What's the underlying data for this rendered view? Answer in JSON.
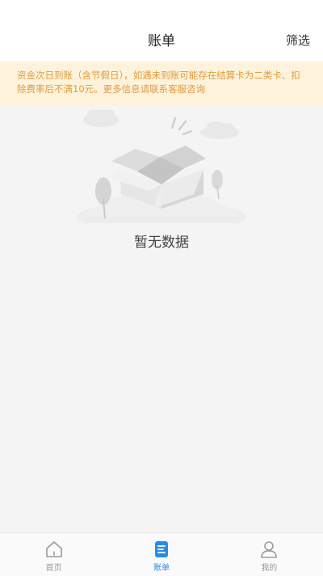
{
  "header": {
    "title": "账单",
    "filter_label": "筛选"
  },
  "notice": {
    "text": "资金次日到账（含节假日），如遇未到账可能存在结算卡为二类卡、扣除费率后不满10元。更多信息请联系客服咨询"
  },
  "empty_state": {
    "text": "暂无数据",
    "illustration": "empty-box-icon"
  },
  "tabbar": {
    "active_color": "#2b8be8",
    "items": [
      {
        "label": "首页",
        "icon": "home-icon",
        "active": false
      },
      {
        "label": "账单",
        "icon": "bill-icon",
        "active": true
      },
      {
        "label": "我的",
        "icon": "user-icon",
        "active": false
      }
    ]
  },
  "colors": {
    "notice_bg": "#fdf3dc",
    "notice_text": "#e29a3c",
    "page_bg": "#f4f4f4"
  }
}
